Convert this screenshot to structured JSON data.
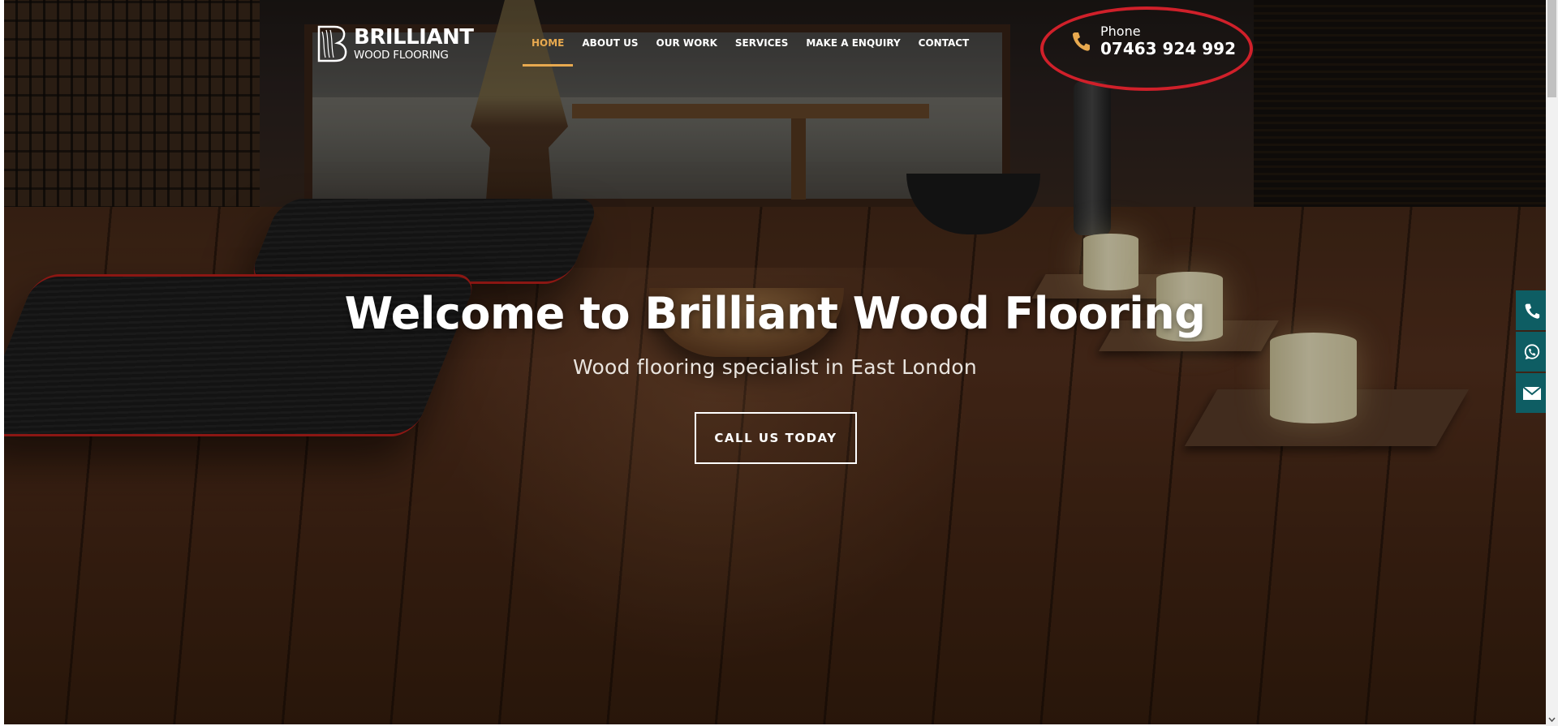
{
  "brand": {
    "name_top": "BRILLIANT",
    "name_bottom": "WOOD FLOORING"
  },
  "nav": {
    "items": [
      {
        "label": "HOME",
        "active": true
      },
      {
        "label": "ABOUT US",
        "active": false
      },
      {
        "label": "OUR WORK",
        "active": false
      },
      {
        "label": "SERVICES",
        "active": false
      },
      {
        "label": "MAKE A ENQUIRY",
        "active": false
      },
      {
        "label": "CONTACT",
        "active": false
      }
    ]
  },
  "contact": {
    "phone_label": "Phone",
    "phone_number": "07463 924 992",
    "icon": "phone-icon"
  },
  "hero": {
    "title": "Welcome to Brilliant Wood Flooring",
    "subtitle": "Wood flooring specialist in East London",
    "cta_label": "CALL US TODAY"
  },
  "side_actions": [
    {
      "icon": "phone-icon"
    },
    {
      "icon": "whatsapp-icon"
    },
    {
      "icon": "envelope-icon"
    }
  ],
  "colors": {
    "accent": "#e8a94f",
    "side_bar": "#0e5d63",
    "annotation": "#d0202a"
  }
}
